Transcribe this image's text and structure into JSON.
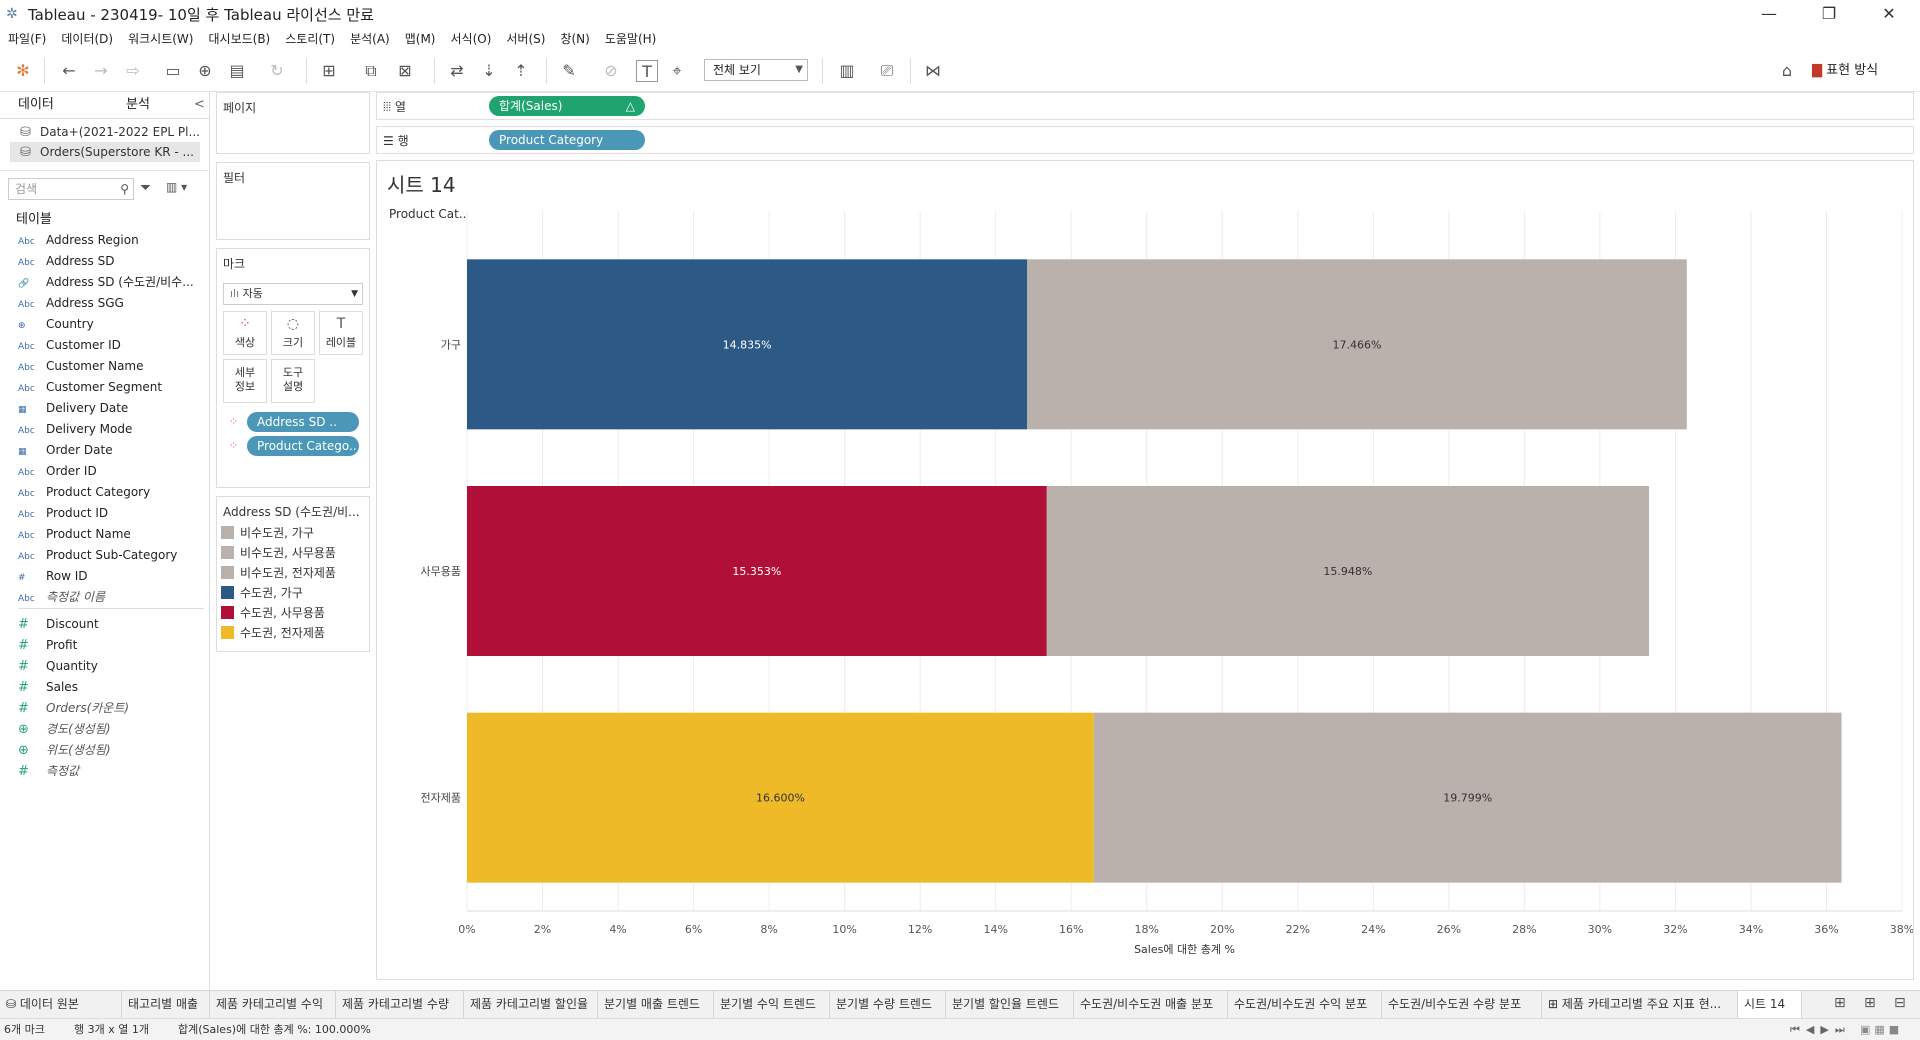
{
  "window": {
    "title": "Tableau - 230419- 10일 후 Tableau 라이선스 만료",
    "minimize": "—",
    "restore": "❐",
    "close": "✕"
  },
  "menu": [
    "파일(F)",
    "데이터(D)",
    "워크시트(W)",
    "대시보드(B)",
    "스토리(T)",
    "분석(A)",
    "맵(M)",
    "서식(O)",
    "서버(S)",
    "창(N)",
    "도움말(H)"
  ],
  "toolbar": {
    "view_select": "전체 보기",
    "show_me": "표현 방식"
  },
  "datapane": {
    "tab_data": "데이터",
    "tab_analysis": "분석",
    "collapse": "<",
    "sources": [
      "Data+(2021-2022 EPL Pl...",
      "Orders(Superstore KR - ..."
    ],
    "search_placeholder": "검색",
    "tables_header": "테이블",
    "dimensions": [
      {
        "type": "Abc",
        "name": "Address Region"
      },
      {
        "type": "Abc",
        "name": "Address SD"
      },
      {
        "type": "🔗",
        "name": "Address SD (수도권/비수..."
      },
      {
        "type": "Abc",
        "name": "Address SGG"
      },
      {
        "type": "⊕",
        "name": "Country"
      },
      {
        "type": "Abc",
        "name": "Customer ID"
      },
      {
        "type": "Abc",
        "name": "Customer Name"
      },
      {
        "type": "Abc",
        "name": "Customer Segment"
      },
      {
        "type": "▦",
        "name": "Delivery Date"
      },
      {
        "type": "Abc",
        "name": "Delivery Mode"
      },
      {
        "type": "▦",
        "name": "Order Date"
      },
      {
        "type": "Abc",
        "name": "Order ID"
      },
      {
        "type": "Abc",
        "name": "Product Category"
      },
      {
        "type": "Abc",
        "name": "Product ID"
      },
      {
        "type": "Abc",
        "name": "Product Name"
      },
      {
        "type": "Abc",
        "name": "Product Sub-Category"
      },
      {
        "type": "#",
        "name": "Row ID"
      },
      {
        "type": "Abc",
        "name": "측정값 이름",
        "italic": true
      }
    ],
    "measures": [
      {
        "type": "#",
        "name": "Discount"
      },
      {
        "type": "#",
        "name": "Profit"
      },
      {
        "type": "#",
        "name": "Quantity"
      },
      {
        "type": "#",
        "name": "Sales"
      },
      {
        "type": "#",
        "name": "Orders(카운트)",
        "italic": true
      },
      {
        "type": "⊕",
        "name": "경도(생성됨)",
        "italic": true
      },
      {
        "type": "⊕",
        "name": "위도(생성됨)",
        "italic": true
      },
      {
        "type": "#",
        "name": "측정값",
        "italic": true
      }
    ]
  },
  "cards": {
    "pages": "페이지",
    "filters": "필터",
    "marks": "마크",
    "mark_type": "자동",
    "mark_buttons": [
      {
        "label": "색상",
        "icon": "⁘"
      },
      {
        "label": "크기",
        "icon": "◌"
      },
      {
        "label": "레이블",
        "icon": "T"
      },
      {
        "label": "세부\n정보",
        "icon": ""
      },
      {
        "label": "도구\n설명",
        "icon": ""
      }
    ],
    "mark_pills": [
      "Address SD ..",
      "Product Catego.."
    ],
    "legend_title": "Address SD (수도권/비...",
    "legend": [
      {
        "label": "비수도권, 가구",
        "color": "#bab0ac"
      },
      {
        "label": "비수도권, 사무용품",
        "color": "#bab0ac"
      },
      {
        "label": "비수도권, 전자제품",
        "color": "#bab0ac"
      },
      {
        "label": "수도권, 가구",
        "color": "#2c5985"
      },
      {
        "label": "수도권, 사무용품",
        "color": "#b01038"
      },
      {
        "label": "수도권, 전자제품",
        "color": "#efba27"
      }
    ]
  },
  "shelves": {
    "columns_label": "열",
    "rows_label": "행",
    "columns_pill": "합계(Sales)",
    "columns_pill_delta": "△",
    "rows_pill": "Product Category"
  },
  "sheet": {
    "title": "시트 14",
    "row_header": "Product Cat.."
  },
  "chart_data": {
    "type": "bar",
    "orientation": "horizontal",
    "stacked": true,
    "categories": [
      "가구",
      "사무용품",
      "전자제품"
    ],
    "series": [
      {
        "name": "수도권",
        "values": [
          14.835,
          15.353,
          16.6
        ],
        "labels": [
          "14.835%",
          "15.353%",
          "16.600%"
        ],
        "colors": [
          "#2c5985",
          "#b01038",
          "#efba27"
        ]
      },
      {
        "name": "비수도권",
        "values": [
          17.466,
          15.948,
          19.799
        ],
        "labels": [
          "17.466%",
          "15.948%",
          "19.799%"
        ],
        "colors": [
          "#bab0ac",
          "#bab0ac",
          "#bab0ac"
        ]
      }
    ],
    "xlabel": "Sales에 대한 총계 %",
    "xlim": [
      0,
      38
    ],
    "xticks": [
      "0%",
      "2%",
      "4%",
      "6%",
      "8%",
      "10%",
      "12%",
      "14%",
      "16%",
      "18%",
      "20%",
      "22%",
      "24%",
      "26%",
      "28%",
      "30%",
      "32%",
      "34%",
      "36%",
      "38%"
    ],
    "grid": true
  },
  "tabs": [
    "데이터 원본",
    "태고리별 매출",
    "제품 카테고리별 수익",
    "제품 카테고리별 수량",
    "제품 카테고리별 할인율",
    "분기별 매출 트렌드",
    "분기별 수익 트렌드",
    "분기별 수량 트렌드",
    "분기별 할인율 트렌드",
    "수도권/비수도권 매출 분포",
    "수도권/비수도권 수익 분포",
    "수도권/비수도권 수량 분포",
    "제품 카테고리별 주요 지표 현...",
    "시트 14"
  ],
  "status": {
    "marks": "6개 마크",
    "rows_cols": "행 3개 x 열 1개",
    "sum": "합계(Sales)에 대한 총계 %: 100.000%"
  }
}
